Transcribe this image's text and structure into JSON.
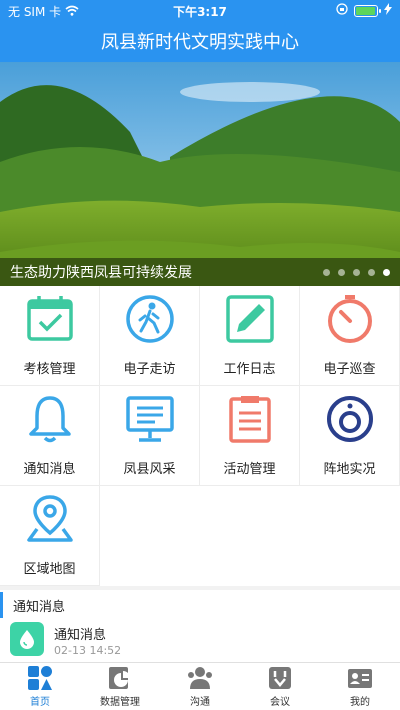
{
  "status": {
    "carrier": "无 SIM 卡",
    "time": "下午3:17",
    "battery_level": 0.95
  },
  "header": {
    "title": "凤县新时代文明实践中心"
  },
  "banner": {
    "caption": "生态助力陕西凤县可持续发展",
    "dot_count": 5,
    "active_index": 4
  },
  "grid": {
    "items": [
      {
        "label": "考核管理",
        "icon": "calendar-check-icon",
        "color": "#3dc9a0"
      },
      {
        "label": "电子走访",
        "icon": "walking-person-icon",
        "color": "#3aa7e8"
      },
      {
        "label": "工作日志",
        "icon": "edit-note-icon",
        "color": "#3dc9a0"
      },
      {
        "label": "电子巡查",
        "icon": "stopwatch-icon",
        "color": "#f07a6a"
      },
      {
        "label": "通知消息",
        "icon": "bell-icon",
        "color": "#3aa7e8"
      },
      {
        "label": "凤县风采",
        "icon": "monitor-icon",
        "color": "#3aa7e8"
      },
      {
        "label": "活动管理",
        "icon": "clipboard-list-icon",
        "color": "#f07a6a"
      },
      {
        "label": "阵地实况",
        "icon": "live-circle-icon",
        "color": "#2a3f8c"
      },
      {
        "label": "区域地图",
        "icon": "map-pin-icon",
        "color": "#3aa7e8"
      }
    ]
  },
  "notice": {
    "section_title": "通知消息",
    "item": {
      "title": "通知消息",
      "time": "02-13 14:52",
      "icon": "water-drop-icon"
    }
  },
  "tabs": [
    {
      "label": "首页",
      "icon": "home-icon",
      "active": true
    },
    {
      "label": "数据管理",
      "icon": "chart-icon",
      "active": false
    },
    {
      "label": "沟通",
      "icon": "people-icon",
      "active": false
    },
    {
      "label": "会议",
      "icon": "meeting-icon",
      "active": false
    },
    {
      "label": "我的",
      "icon": "profile-card-icon",
      "active": false
    }
  ]
}
